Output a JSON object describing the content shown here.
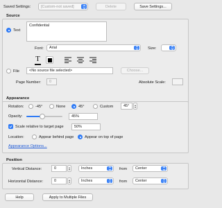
{
  "top": {
    "saved_settings_label": "Saved Settings:",
    "saved_settings_value": "[Custom-not saved]",
    "delete_label": "Delete",
    "save_settings_label": "Save Settings..."
  },
  "source": {
    "title": "Source",
    "text_option": "Text",
    "text_value": "Confidential",
    "font_label": "Font:",
    "font_value": "Arial",
    "size_label": "Size:",
    "size_value": "",
    "text_style_letter": "T",
    "file_option": "File",
    "file_value": "<No source file selected>",
    "choose_label": "Choose...",
    "page_number_label": "Page Number:",
    "page_number_value": "0",
    "absolute_scale_label": "Absolute Scale:",
    "absolute_scale_value": ""
  },
  "appearance": {
    "title": "Appearance",
    "rotation_label": "Rotation:",
    "rot_neg45": "-45°",
    "rot_none": "None",
    "rot_45": "45°",
    "rot_custom": "Custom",
    "rot_custom_value": "45°",
    "opacity_label": "Opacity:",
    "opacity_value": "45%",
    "opacity_level": 0.45,
    "scale_label": "Scale relative to target page",
    "scale_value": "50%",
    "location_label": "Location:",
    "loc_behind": "Appear behind page",
    "loc_top": "Appear on top of page",
    "options_link": "Appearance Options..."
  },
  "position": {
    "title": "Position",
    "vertical_label": "Vertical Distance:",
    "vertical_value": "0",
    "vertical_unit": "Inches",
    "vertical_from_label": "from",
    "vertical_from": "Center",
    "horizontal_label": "Horizontal Distance:",
    "horizontal_value": "0",
    "horizontal_unit": "Inches",
    "horizontal_from_label": "from",
    "horizontal_from": "Center"
  },
  "bottom": {
    "help_label": "Help",
    "apply_multiple_label": "Apply to Multiple Files"
  },
  "colors": {
    "accent": "#2f7bf6",
    "panel_bg": "#ececec",
    "window_bg": "#e8e8e8"
  }
}
